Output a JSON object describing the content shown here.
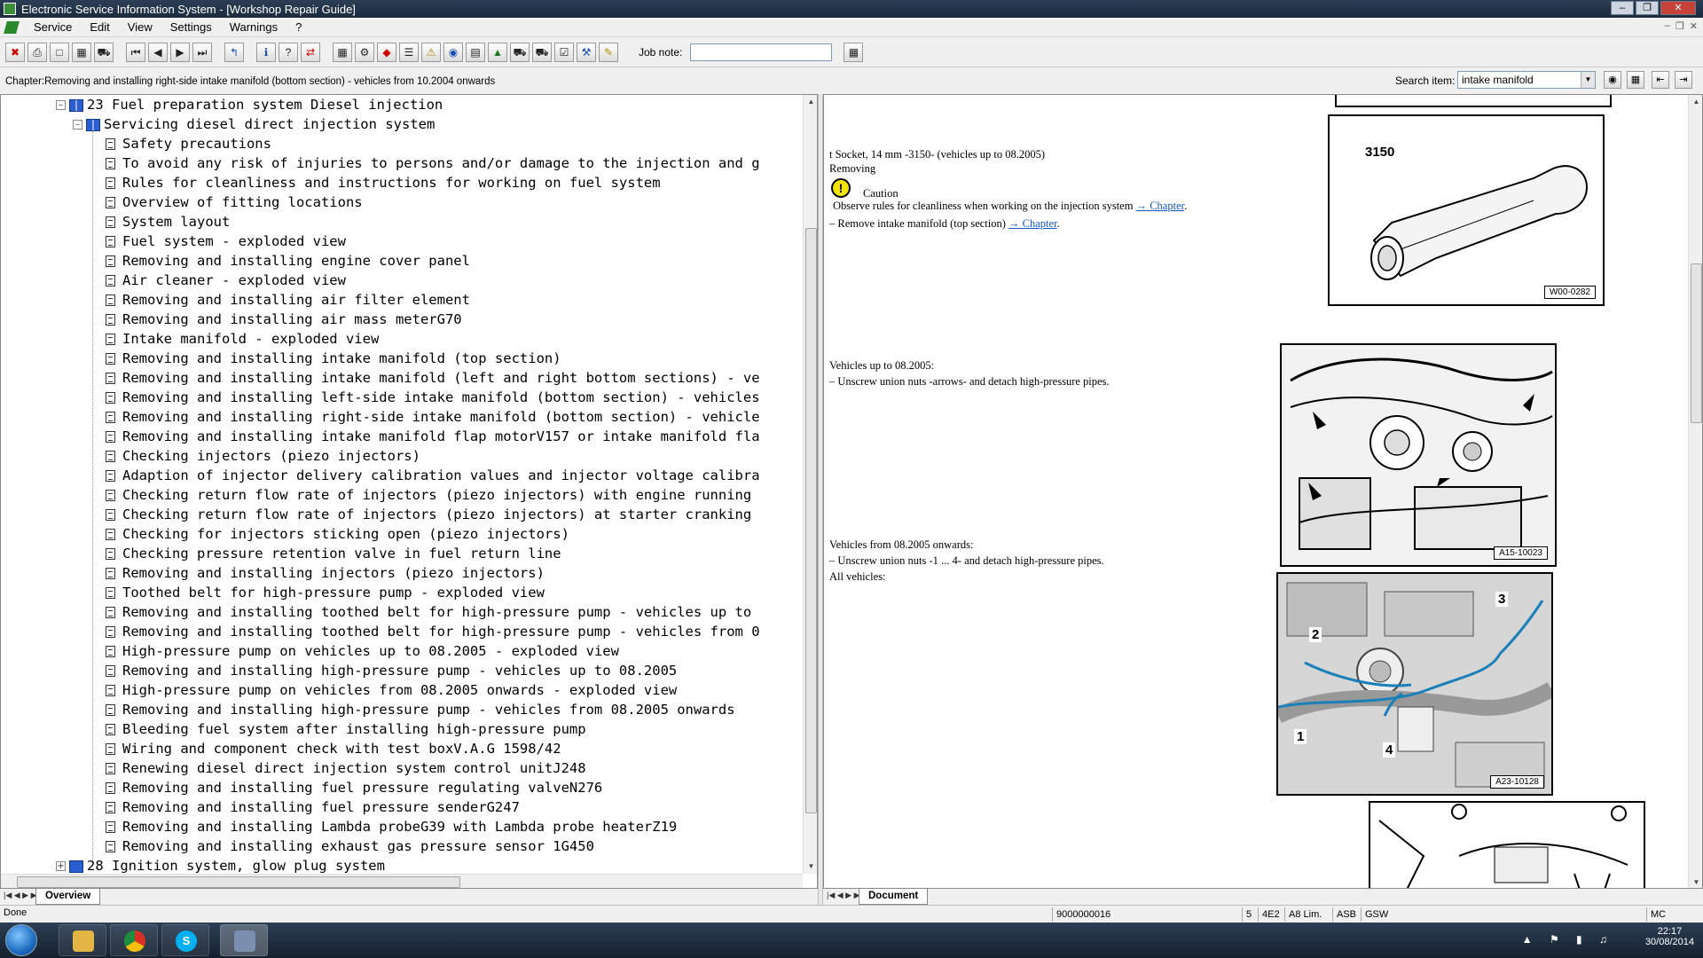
{
  "window": {
    "title": "Electronic Service Information System - [Workshop Repair Guide]"
  },
  "menu": {
    "items": [
      "Service",
      "Edit",
      "View",
      "Settings",
      "Warnings",
      "?"
    ]
  },
  "toolbar": {
    "job_note_label": "Job note:",
    "job_note_value": ""
  },
  "chapter_bar": {
    "text": "Chapter:Removing and installing right-side intake manifold (bottom section) - vehicles from 10.2004 onwards",
    "search_label": "Search item:",
    "search_value": "intake manifold"
  },
  "tree": {
    "section": "23 Fuel preparation system Diesel injection",
    "subsection": "Servicing diesel direct injection system",
    "items": [
      "Safety precautions",
      "To avoid any risk of injuries to persons and/or damage to the injection and g",
      "Rules for cleanliness and instructions for working on fuel system",
      "Overview of fitting locations",
      "System layout",
      "Fuel system - exploded view",
      "Removing and installing engine cover panel",
      "Air cleaner - exploded view",
      "Removing and installing air filter element",
      "Removing and installing air mass meterG70",
      "Intake manifold - exploded view",
      "Removing and installing intake manifold (top section)",
      "Removing and installing intake manifold (left and right bottom sections) - ve",
      "Removing and installing left-side intake manifold (bottom section) - vehicles",
      "Removing and installing right-side intake manifold (bottom section) - vehicle",
      "Removing and installing intake manifold flap motorV157 or intake manifold fla",
      "Checking injectors (piezo injectors)",
      "Adaption of injector delivery calibration values and injector voltage calibra",
      "Checking return flow rate of injectors (piezo injectors) with engine running",
      "Checking return flow rate of injectors (piezo injectors) at starter cranking",
      "Checking for injectors sticking open (piezo injectors)",
      "Checking pressure retention valve in fuel return line",
      "Removing and installing injectors (piezo injectors)",
      "Toothed belt for high-pressure pump - exploded view",
      "Removing and installing toothed belt for high-pressure pump - vehicles up to",
      "Removing and installing toothed belt for high-pressure pump - vehicles from 0",
      "High-pressure pump on vehicles up to 08.2005 - exploded view",
      "Removing and installing high-pressure pump - vehicles up to 08.2005",
      "High-pressure pump on vehicles from 08.2005 onwards - exploded view",
      "Removing and installing high-pressure pump - vehicles from 08.2005 onwards",
      "Bleeding fuel system after installing high-pressure pump",
      "Wiring and component check with test boxV.A.G 1598/42",
      "Renewing diesel direct injection system control unitJ248",
      "Removing and installing fuel pressure regulating valveN276",
      "Removing and installing fuel pressure senderG247",
      "Removing and installing Lambda probeG39 with Lambda probe heaterZ19",
      "Removing and installing exhaust gas pressure sensor 1G450"
    ],
    "next_section": "28 Ignition system, glow plug system"
  },
  "left_tab": "Overview",
  "right_tab": "Document",
  "document": {
    "socket_line": "t  Socket, 14 mm -3150- (vehicles up to 08.2005)",
    "removing": "Removing",
    "caution": "Caution",
    "caution_text": "Observe rules for cleanliness when working on the injection system",
    "caution_link": "→ Chapter",
    "step1_text": "–  Remove intake manifold (top section)",
    "step1_link": "→ Chapter",
    "step1_end": ".",
    "vehicles_up_to": "Vehicles up to 08.2005:",
    "unscrew_arrows": "–  Unscrew union nuts -arrows- and detach high-pressure pipes.",
    "vehicles_from": "Vehicles from 08.2005 onwards:",
    "unscrew_numbers": "–  Unscrew union nuts -1 ... 4- and detach high-pressure pipes.",
    "all_vehicles": "All vehicles:",
    "fig1_number": "3150",
    "fig1_code": "W00-0282",
    "fig2_code": "A15-10023",
    "fig3_code": "A23-10128",
    "fig3_labels": [
      "1",
      "2",
      "3",
      "4"
    ]
  },
  "status": {
    "left": "Done",
    "code": "9000000016",
    "c1": "5",
    "c2": "4E2",
    "c3": "A8 Lim.",
    "c4": "ASB",
    "c5": "GSW",
    "c6": "MC"
  },
  "taskbar": {
    "time": "22:17",
    "date": "30/08/2014"
  }
}
